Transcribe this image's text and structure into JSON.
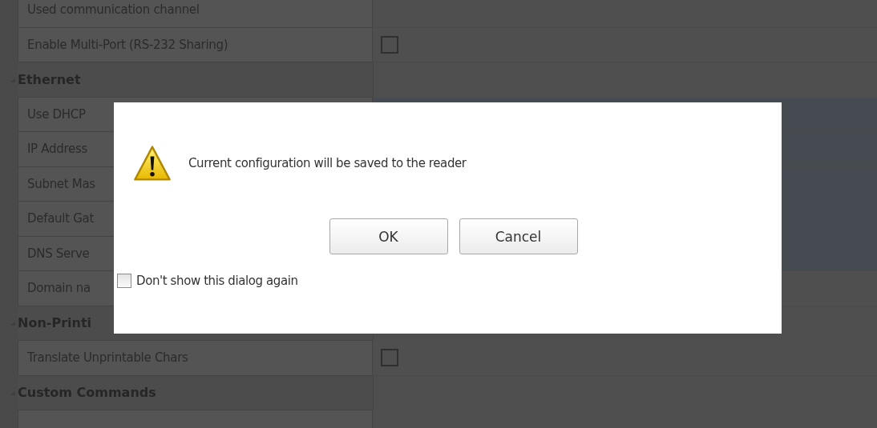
{
  "property_grid": {
    "rows": [
      {
        "kind": "property",
        "label": "Used communication channel"
      },
      {
        "kind": "property",
        "label": "Enable Multi-Port (RS-232 Sharing)",
        "value": {
          "kind": "checkbox",
          "checked": false
        }
      },
      {
        "kind": "category",
        "label": "Ethernet",
        "expanded": true
      },
      {
        "kind": "property",
        "label": "Use DHCP",
        "value": {
          "kind": "text"
        }
      },
      {
        "kind": "property",
        "label": "IP Address",
        "value": {
          "kind": "text"
        }
      },
      {
        "kind": "property",
        "label": "Subnet Mas",
        "value": {
          "kind": "text"
        }
      },
      {
        "kind": "property",
        "label": "Default Gat",
        "value": {
          "kind": "text"
        }
      },
      {
        "kind": "property",
        "label": "DNS Serve",
        "value": {
          "kind": "text"
        }
      },
      {
        "kind": "property",
        "label": "Domain na"
      },
      {
        "kind": "category",
        "label": "Non-Printi",
        "expanded": true
      },
      {
        "kind": "property",
        "label": "Translate Unprintable Chars",
        "value": {
          "kind": "checkbox",
          "checked": false
        }
      },
      {
        "kind": "category",
        "label": "Custom Commands",
        "expanded": true
      },
      {
        "kind": "property"
      }
    ]
  },
  "dialog": {
    "message": "Current configuration will be saved to the reader",
    "buttons": [
      "OK",
      "Cancel"
    ],
    "dont_show": {
      "label": "Don't show this dialog again",
      "checked": false
    }
  }
}
